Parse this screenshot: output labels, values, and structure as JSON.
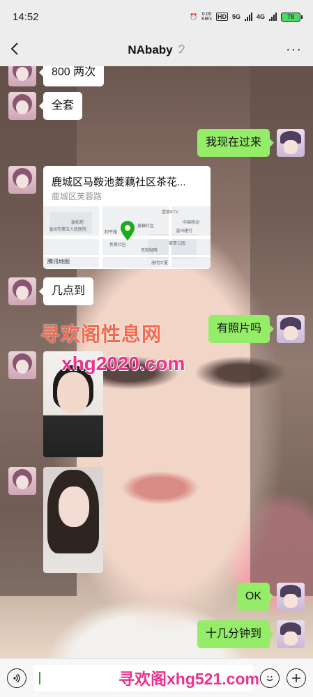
{
  "status_bar": {
    "time": "14:52",
    "net_speed": "0.00\nKB/s",
    "hd": "HD",
    "net_5g": "5G",
    "net_4g": "4G",
    "battery": "78"
  },
  "header": {
    "title": "NAbaby",
    "ear_icon": "ear-icon",
    "more": "···"
  },
  "messages": [
    {
      "side": "in",
      "type": "text",
      "text": "800 两次"
    },
    {
      "side": "in",
      "type": "text",
      "text": "全套"
    },
    {
      "side": "out",
      "type": "text",
      "text": "我现在过来"
    },
    {
      "side": "in",
      "type": "location",
      "title": "鹿城区马鞍池菱藕社区茶花...",
      "subtitle": "鹿城区芙蓉路",
      "provider": "腾讯地图",
      "map_labels": [
        "壹度KTV",
        "泰和苑",
        "温州市第五人民医院",
        "和平路",
        "菱藕社区",
        "中国移动",
        "温州建行",
        "新奥社区",
        "无限咖啡",
        "姜亚公园",
        "施明大厦"
      ]
    },
    {
      "side": "in",
      "type": "text",
      "text": "几点到"
    },
    {
      "side": "out",
      "type": "text",
      "text": "有照片吗"
    },
    {
      "side": "in",
      "type": "image"
    },
    {
      "side": "in",
      "type": "image"
    },
    {
      "side": "out",
      "type": "text",
      "text": "OK"
    },
    {
      "side": "out",
      "type": "text",
      "text": "十几分钟到"
    }
  ],
  "watermarks": {
    "line1": "寻欢阁性息网",
    "line2": "xhg2020.com",
    "line3": "寻欢阁xhg521.com"
  },
  "input_bar": {
    "voice_icon": "voice-icon",
    "emoji_icon": "emoji-icon",
    "plus_icon": "plus-icon"
  },
  "colors": {
    "out_bubble": "#95ec69",
    "in_bubble": "#ffffff",
    "bar_bg": "#ededed",
    "watermark_pink": "#e8348c",
    "watermark_orange": "#f26a4f"
  }
}
